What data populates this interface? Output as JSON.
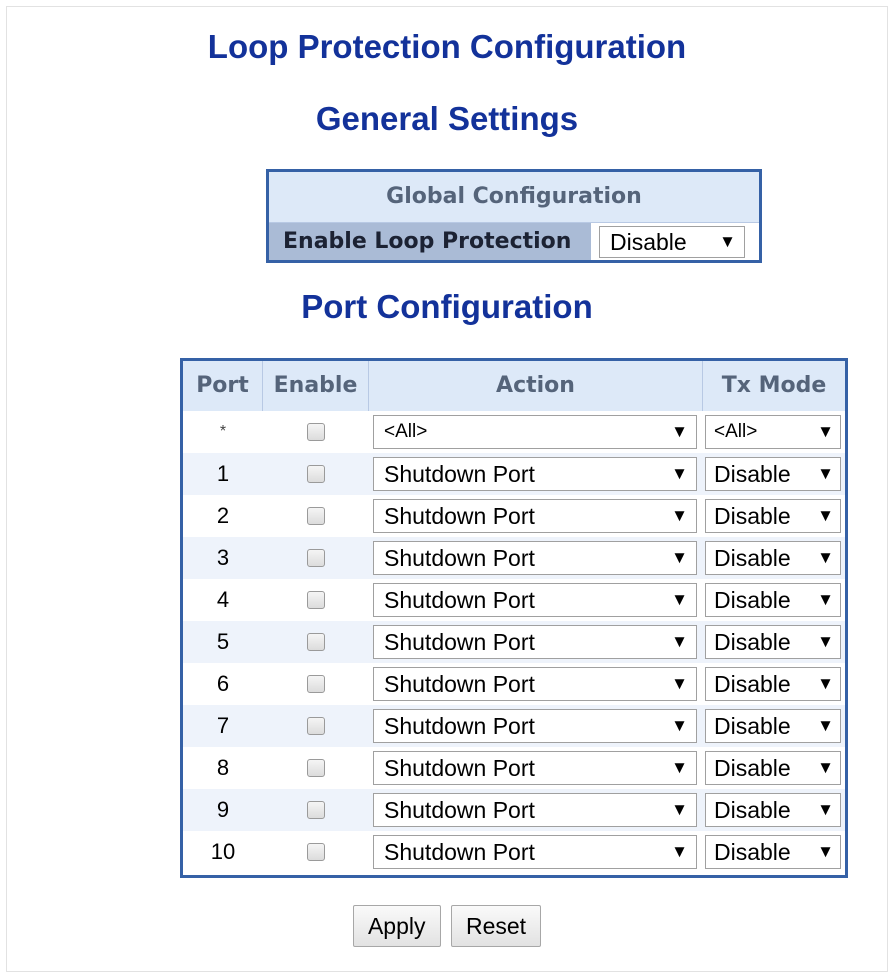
{
  "page": {
    "title": "Loop Protection Configuration",
    "general_heading": "General Settings",
    "port_heading": "Port Configuration"
  },
  "global": {
    "header": "Global Configuration",
    "enable_label": "Enable Loop Protection",
    "enable_value": "Disable"
  },
  "port_table": {
    "headers": {
      "port": "Port",
      "enable": "Enable",
      "action": "Action",
      "tx_mode": "Tx Mode"
    },
    "rows": [
      {
        "port": "*",
        "enabled": false,
        "action": "<All>",
        "tx_mode": "<All>"
      },
      {
        "port": "1",
        "enabled": false,
        "action": "Shutdown Port",
        "tx_mode": "Disable"
      },
      {
        "port": "2",
        "enabled": false,
        "action": "Shutdown Port",
        "tx_mode": "Disable"
      },
      {
        "port": "3",
        "enabled": false,
        "action": "Shutdown Port",
        "tx_mode": "Disable"
      },
      {
        "port": "4",
        "enabled": false,
        "action": "Shutdown Port",
        "tx_mode": "Disable"
      },
      {
        "port": "5",
        "enabled": false,
        "action": "Shutdown Port",
        "tx_mode": "Disable"
      },
      {
        "port": "6",
        "enabled": false,
        "action": "Shutdown Port",
        "tx_mode": "Disable"
      },
      {
        "port": "7",
        "enabled": false,
        "action": "Shutdown Port",
        "tx_mode": "Disable"
      },
      {
        "port": "8",
        "enabled": false,
        "action": "Shutdown Port",
        "tx_mode": "Disable"
      },
      {
        "port": "9",
        "enabled": false,
        "action": "Shutdown Port",
        "tx_mode": "Disable"
      },
      {
        "port": "10",
        "enabled": false,
        "action": "Shutdown Port",
        "tx_mode": "Disable"
      }
    ]
  },
  "buttons": {
    "apply": "Apply",
    "reset": "Reset"
  },
  "icons": {
    "dropdown": "dropdown-arrow-icon",
    "dropdown_glyph": "▼"
  },
  "colors": {
    "heading": "#13329a",
    "table_border": "#3561a6",
    "header_bg": "#dde9f8",
    "label_bg": "#aabbd6"
  }
}
